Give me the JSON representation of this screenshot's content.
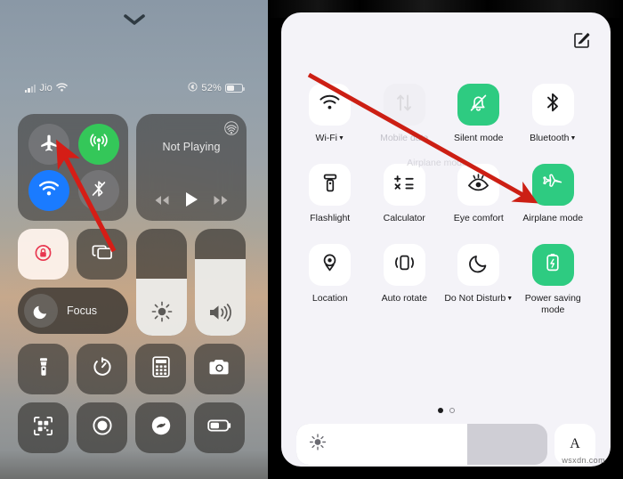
{
  "ios": {
    "status_bar": {
      "carrier": "Jio",
      "battery_percent": "52%",
      "signal_icon": "cellular-bars-icon",
      "wifi_icon": "wifi-icon",
      "focus_indicator_icon": "focus-moon-indicator-icon",
      "battery_icon": "battery-icon"
    },
    "grab_handle_icon": "chevron-down-icon",
    "connectivity": {
      "airplane": {
        "label": "Airplane Mode",
        "icon": "airplane-icon",
        "state": "off",
        "color": "#808082"
      },
      "cellular": {
        "label": "Cellular Data",
        "icon": "cellular-signal-icon",
        "state": "on",
        "color": "#34c759"
      },
      "wifi": {
        "label": "Wi-Fi",
        "icon": "wifi-icon",
        "state": "on",
        "color": "#1a7bff"
      },
      "bluetooth": {
        "label": "Bluetooth",
        "icon": "bluetooth-off-icon",
        "state": "off",
        "color": "#808082"
      }
    },
    "now_playing": {
      "title": "Not Playing",
      "airplay_icon": "airplay-icon",
      "rewind_icon": "rewind-icon",
      "play_icon": "play-icon",
      "forward_icon": "fast-forward-icon"
    },
    "tiles": {
      "rotation_lock": {
        "label": "Rotation Lock",
        "icon": "rotation-lock-icon",
        "state": "on",
        "color": "#e8364f"
      },
      "screen_mirroring": {
        "label": "Screen Mirroring",
        "icon": "screen-mirroring-icon",
        "state": "off"
      },
      "focus": {
        "label": "Focus",
        "icon": "moon-icon"
      },
      "flashlight": {
        "label": "Flashlight",
        "icon": "flashlight-icon"
      },
      "timer": {
        "label": "Timer",
        "icon": "timer-icon"
      },
      "calculator": {
        "label": "Calculator",
        "icon": "calculator-icon"
      },
      "camera": {
        "label": "Camera",
        "icon": "camera-icon"
      },
      "qr_scanner": {
        "label": "Code Scanner",
        "icon": "qr-code-icon"
      },
      "screen_record": {
        "label": "Screen Recording",
        "icon": "record-icon"
      },
      "shazam": {
        "label": "Music Recognition",
        "icon": "shazam-icon"
      },
      "low_power": {
        "label": "Low Power Mode",
        "icon": "battery-low-icon"
      }
    },
    "sliders": {
      "brightness": {
        "label": "Brightness",
        "icon": "brightness-sun-icon",
        "value": 53
      },
      "volume": {
        "label": "Volume",
        "icon": "volume-icon",
        "value": 72
      }
    }
  },
  "android": {
    "edit_icon": "edit-pencil-square-icon",
    "tiles": [
      {
        "label": "Wi-Fi",
        "icon": "wifi-icon",
        "state": "off",
        "has_caret": true,
        "faded": false
      },
      {
        "label": "Mobile data",
        "icon": "mobile-data-icon",
        "state": "disabled",
        "has_caret": false,
        "faded": true
      },
      {
        "label": "Silent mode",
        "icon": "bell-mute-icon",
        "state": "on",
        "has_caret": false,
        "faded": false
      },
      {
        "label": "Bluetooth",
        "icon": "bluetooth-icon",
        "state": "off",
        "has_caret": true,
        "faded": false
      },
      {
        "label": "Flashlight",
        "icon": "flashlight-icon",
        "state": "off",
        "has_caret": false,
        "faded": false
      },
      {
        "label": "Calculator",
        "icon": "calculator-icon",
        "state": "off",
        "has_caret": false,
        "faded": false
      },
      {
        "label": "Eye comfort",
        "icon": "eye-comfort-icon",
        "state": "off",
        "has_caret": false,
        "faded": false
      },
      {
        "label": "Airplane mode",
        "icon": "airplane-icon",
        "state": "on",
        "has_caret": false,
        "faded": false
      },
      {
        "label": "Location",
        "icon": "location-pin-icon",
        "state": "off",
        "has_caret": false,
        "faded": false
      },
      {
        "label": "Auto rotate",
        "icon": "auto-rotate-icon",
        "state": "off",
        "has_caret": false,
        "faded": false
      },
      {
        "label": "Do Not Disturb",
        "icon": "moon-icon",
        "state": "off",
        "has_caret": true,
        "faded": false
      },
      {
        "label": "Power saving mode",
        "icon": "battery-saver-icon",
        "state": "on",
        "has_caret": false,
        "faded": false
      }
    ],
    "mobile_data_sublabel": "Airplane mode",
    "pager": {
      "current": 1,
      "total": 2
    },
    "brightness": {
      "icon": "brightness-sun-icon",
      "value": 68
    },
    "auto_brightness_label": "A",
    "accent_on_color": "#2ecb81",
    "card_bg_color": "#f4f3f8"
  },
  "annotations": {
    "left_arrow": {
      "name": "red-arrow-to-airplane-ios",
      "color": "#d51d16"
    },
    "right_arrow": {
      "name": "red-arrow-to-airplane-android",
      "color": "#cc1f14"
    }
  },
  "watermark": {
    "text": "wsxdn.com"
  }
}
